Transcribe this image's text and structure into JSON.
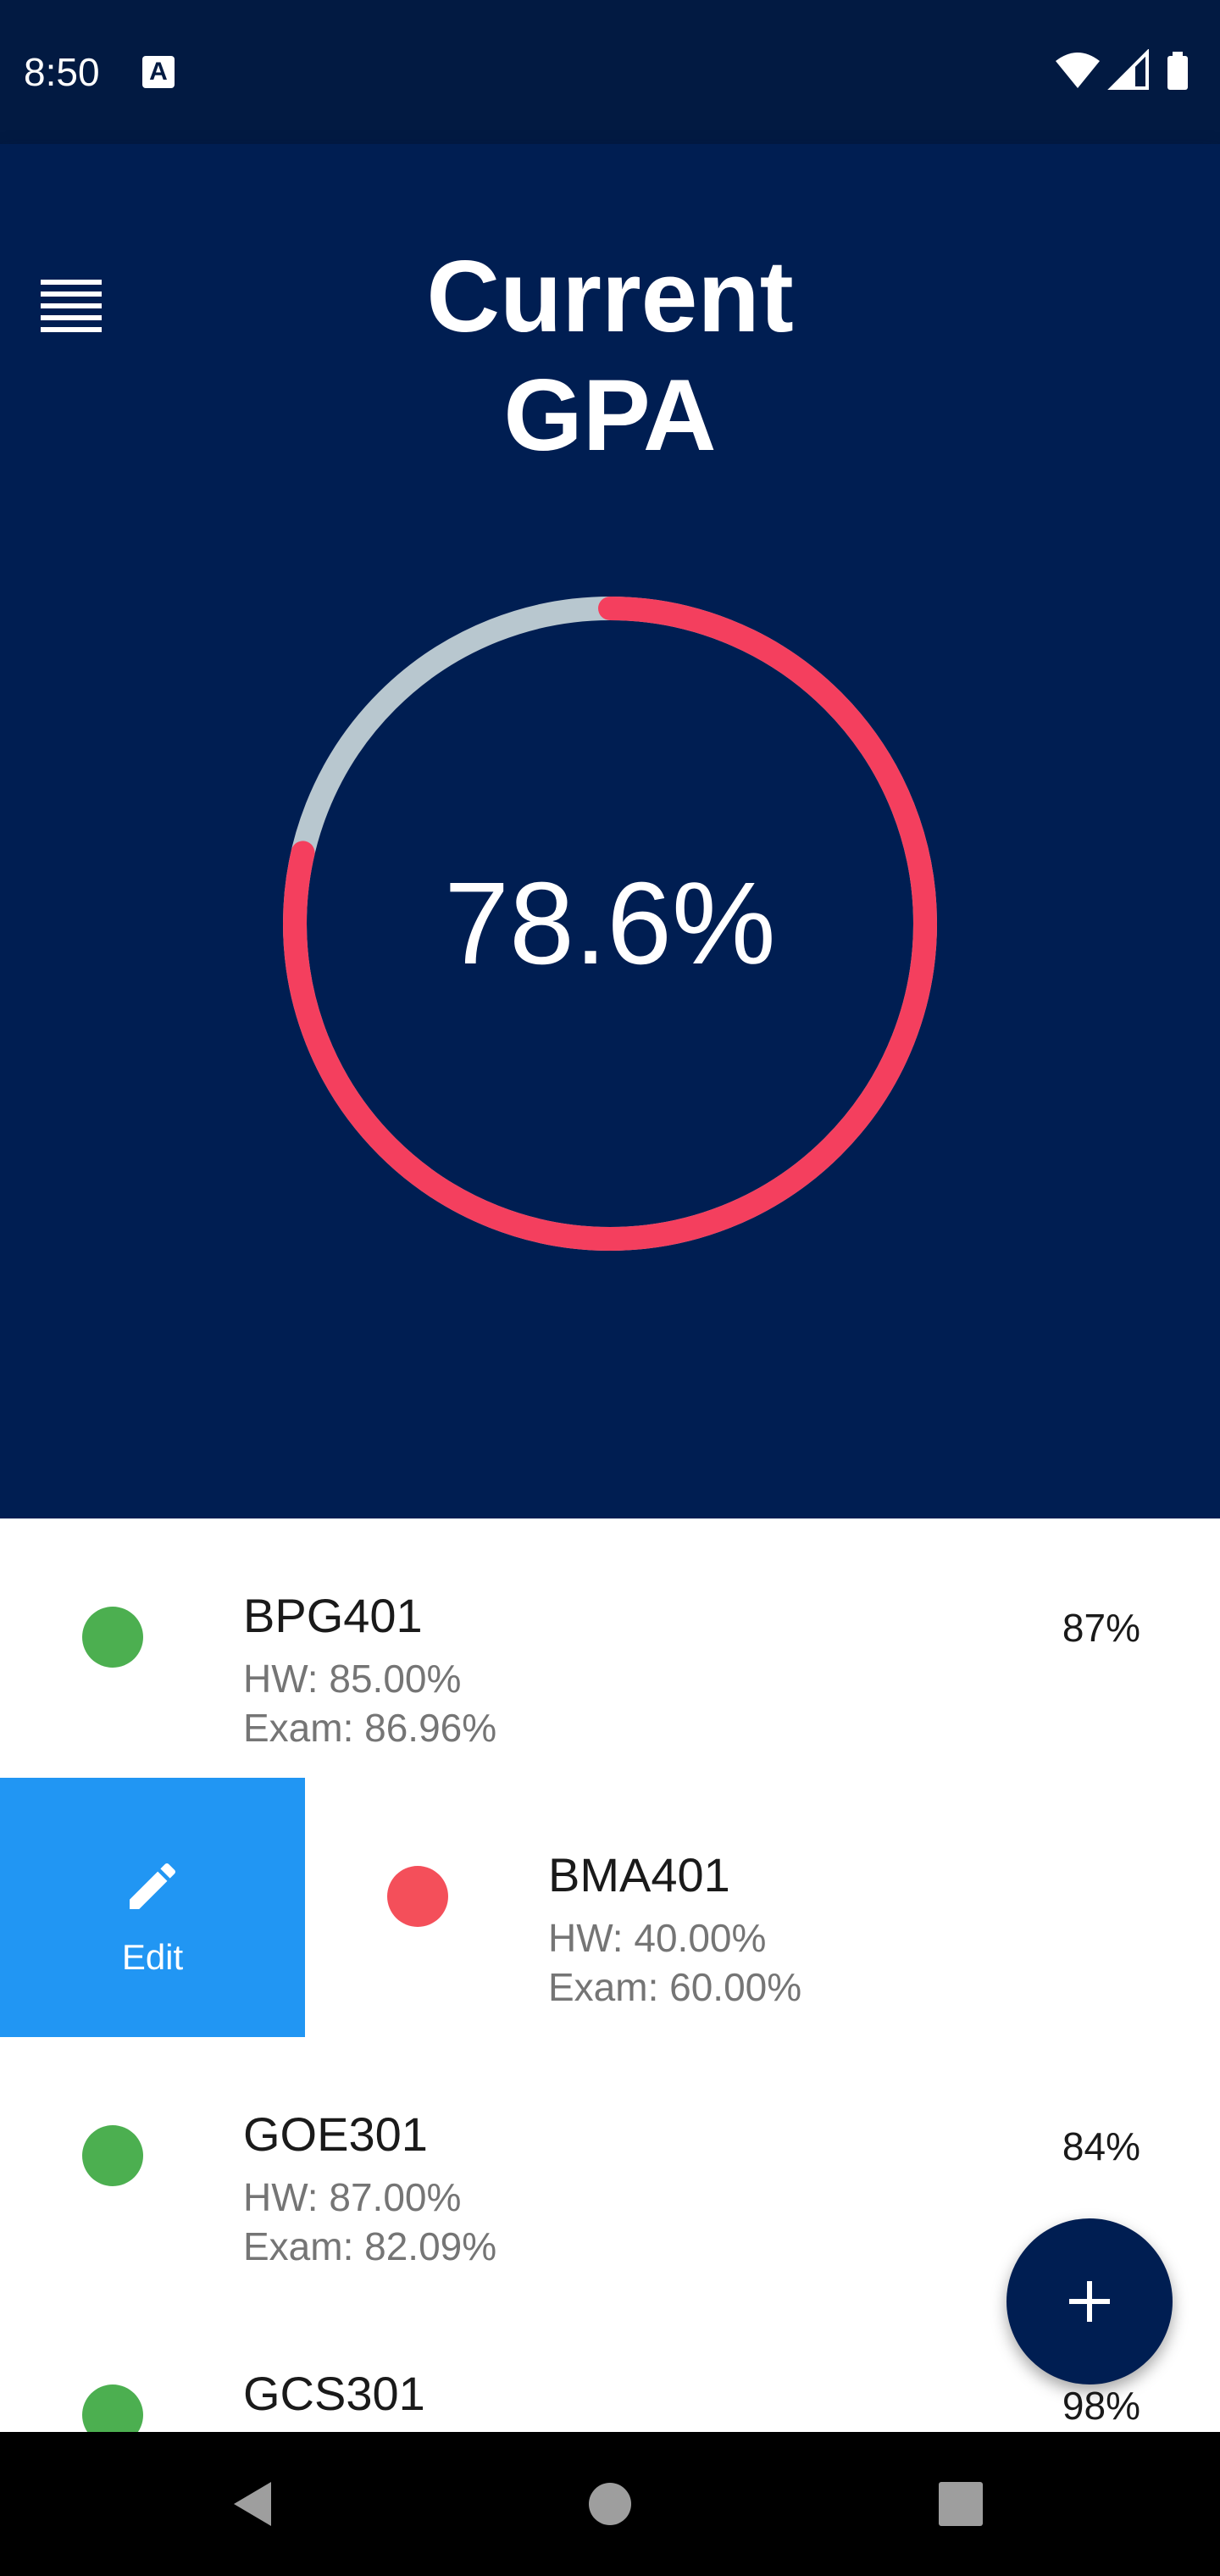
{
  "status_bar": {
    "time": "8:50",
    "notification_icon": "a-notification-icon",
    "icons": [
      "wifi-icon",
      "cell-signal-icon",
      "battery-icon"
    ]
  },
  "header": {
    "title_line1": "Current",
    "title_line2": "GPA",
    "menu_icon": "menu-icon"
  },
  "gpa": {
    "value": "78.6%",
    "ring_fill_fraction": 0.786,
    "colors": {
      "track": "#b8c7cf",
      "progress": "#f43f5e",
      "background": "#001e52"
    }
  },
  "courses": [
    {
      "code": "BPG401",
      "hw": "HW: 85.00%",
      "exam": "Exam: 86.96%",
      "grade": "87%",
      "status": "good",
      "dot_color": "#4caf50"
    },
    {
      "code": "BMA401",
      "hw": "HW: 40.00%",
      "exam": "Exam: 60.00%",
      "grade": "",
      "status": "bad",
      "dot_color": "#f44f5a",
      "swiped": true
    },
    {
      "code": "GOE301",
      "hw": "HW: 87.00%",
      "exam": "Exam: 82.09%",
      "grade": "84%",
      "status": "good",
      "dot_color": "#4caf50"
    },
    {
      "code": "GCS301",
      "hw": "",
      "exam": "",
      "grade": "98%",
      "status": "good",
      "dot_color": "#4caf50"
    }
  ],
  "swipe_action": {
    "label": "Edit",
    "icon": "pencil-icon",
    "color": "#2196f3"
  },
  "fab": {
    "icon": "plus-icon"
  },
  "nav_bar": {
    "icons": [
      "back-icon",
      "home-icon",
      "recents-icon"
    ]
  }
}
